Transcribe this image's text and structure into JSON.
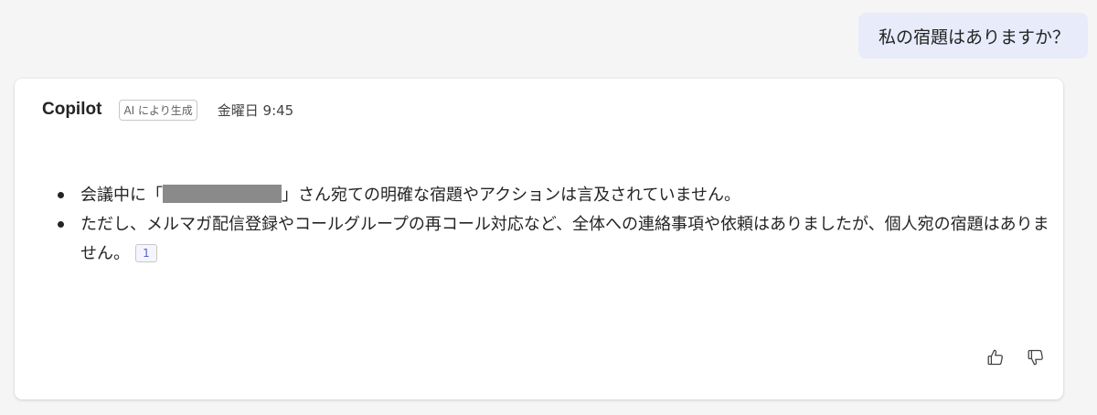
{
  "user_message": {
    "text": "私の宿題はありますか？"
  },
  "response": {
    "sender": "Copilot",
    "ai_badge": "AI により生成",
    "timestamp": "金曜日 9:45",
    "bullets": [
      {
        "prefix": "会議中に「",
        "redacted": true,
        "suffix": "」さん宛ての明確な宿題やアクションは言及されていません。"
      },
      {
        "text": "ただし、メルマガ配信登録やコールグループの再コール対応など、全体への連絡事項や依頼はありましたが、個人宛の宿題はありません。",
        "citation": "1"
      }
    ]
  },
  "feedback": {
    "like_icon": "thumbs-up-icon",
    "dislike_icon": "thumbs-down-icon"
  },
  "colors": {
    "background": "#f5f5f5",
    "user_bubble": "#e8ebfa",
    "card": "#ffffff",
    "citation_text": "#5b5fc7",
    "redaction": "#8a8a8a"
  }
}
